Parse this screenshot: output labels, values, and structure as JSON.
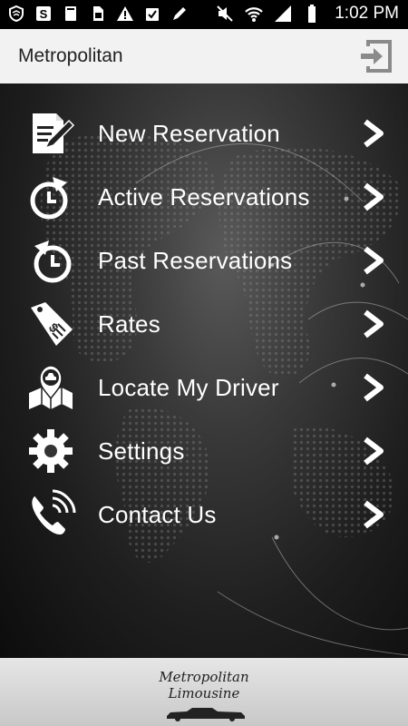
{
  "status_bar": {
    "time": "1:02 PM",
    "left_icons": [
      "shield-icon",
      "s-app-icon",
      "clipboard-icon",
      "sim-icon",
      "warning-icon",
      "checkbox-icon",
      "pen-icon"
    ],
    "right_icons": [
      "mute-icon",
      "wifi-icon",
      "signal-icon",
      "battery-icon"
    ]
  },
  "app_bar": {
    "title": "Metropolitan",
    "action_icon": "logout-icon"
  },
  "menu": {
    "items": [
      {
        "label": "New Reservation",
        "icon": "new-reservation-icon"
      },
      {
        "label": "Active Reservations",
        "icon": "clock-forward-icon"
      },
      {
        "label": "Past Reservations",
        "icon": "clock-history-icon"
      },
      {
        "label": "Rates",
        "icon": "price-tag-icon"
      },
      {
        "label": "Locate My Driver",
        "icon": "map-car-icon"
      },
      {
        "label": "Settings",
        "icon": "gear-icon"
      },
      {
        "label": "Contact Us",
        "icon": "phone-icon"
      }
    ]
  },
  "footer": {
    "brand_line1": "Metropolitan",
    "brand_line2": "Limousine"
  },
  "colors": {
    "status_bar_bg": "#000000",
    "app_bar_bg": "#f2f2f2",
    "menu_text": "#ffffff",
    "footer_bg": "#d6d6d6"
  }
}
